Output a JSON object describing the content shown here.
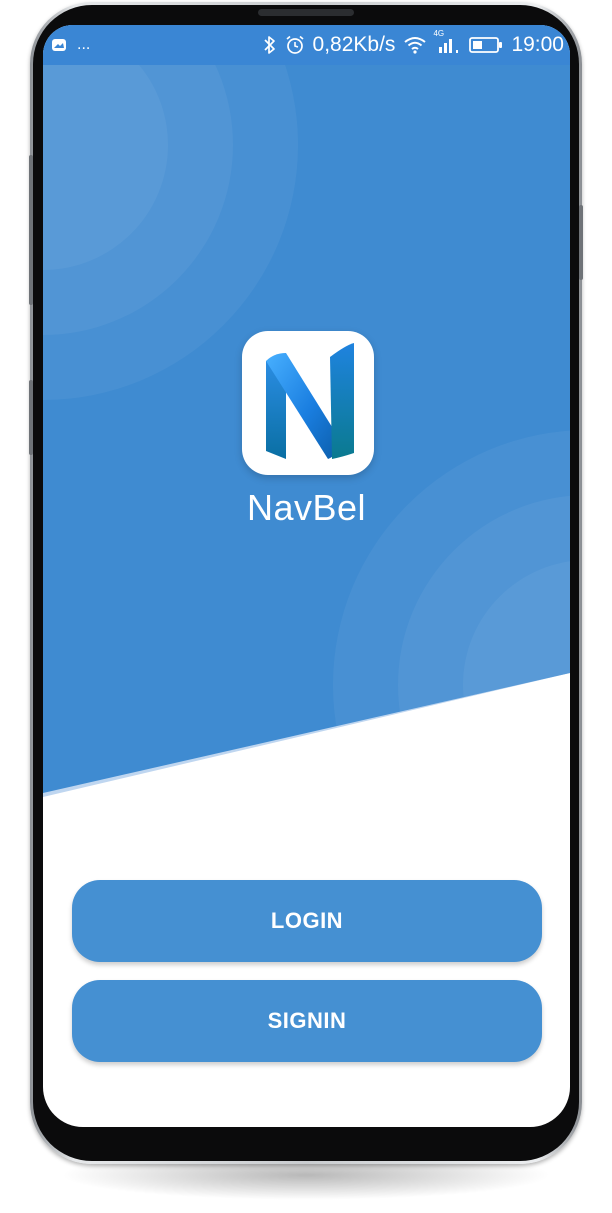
{
  "status_bar": {
    "left_icons": [
      "notification-icon"
    ],
    "left_more": "...",
    "icons": [
      "bluetooth-icon",
      "alarm-icon"
    ],
    "network_speed": "0,82Kb/s",
    "signal": "4G",
    "time": "19:00"
  },
  "app": {
    "name": "NavBel",
    "logo_icon": "navbel-n-logo-icon"
  },
  "buttons": {
    "login_label": "LOGIN",
    "signin_label": "SIGNIN"
  },
  "colors": {
    "primary": "#3f8bd1",
    "button": "#4590d2",
    "background": "#ffffff"
  }
}
